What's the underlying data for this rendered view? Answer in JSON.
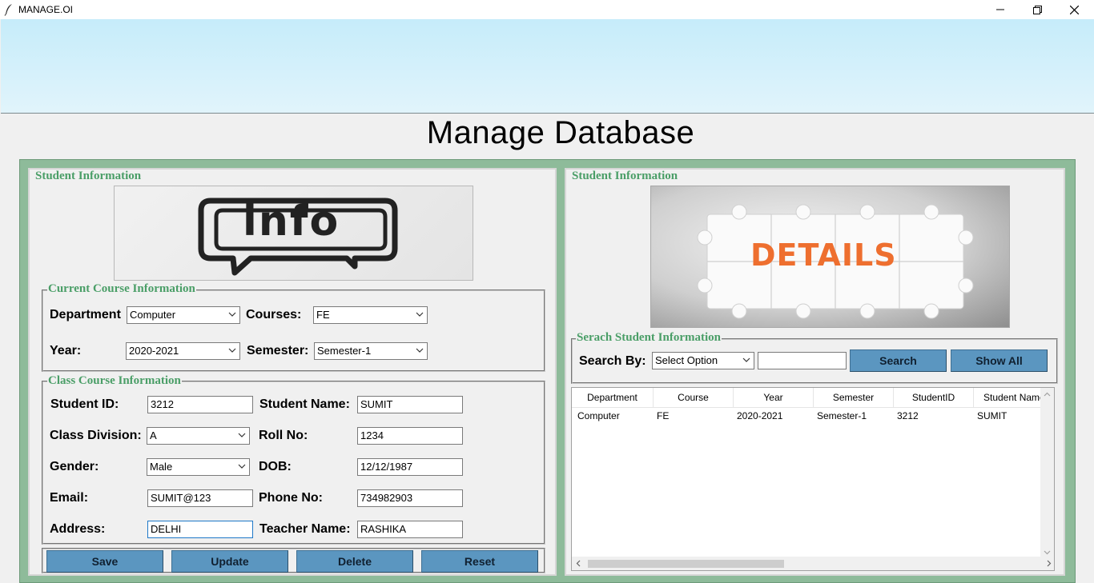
{
  "window": {
    "title": "MANAGE.OI",
    "app_icon": "feather-icon"
  },
  "page": {
    "title": "Manage Database"
  },
  "left_panel": {
    "title": "Student Information",
    "image_text": "info",
    "current_course": {
      "legend": "Current Course Information",
      "department_label": "Department",
      "department_value": "Computer",
      "courses_label": "Courses:",
      "courses_value": "FE",
      "year_label": "Year:",
      "year_value": "2020-2021",
      "semester_label": "Semester:",
      "semester_value": "Semester-1"
    },
    "class_course": {
      "legend": "Class Course Information",
      "student_id_label": "Student ID:",
      "student_id_value": "3212",
      "student_name_label": "Student Name:",
      "student_name_value": "SUMIT",
      "class_division_label": "Class Division:",
      "class_division_value": "A",
      "roll_no_label": "Roll No:",
      "roll_no_value": "1234",
      "gender_label": "Gender:",
      "gender_value": "Male",
      "dob_label": "DOB:",
      "dob_value": "12/12/1987",
      "email_label": "Email:",
      "email_value": "SUMIT@123",
      "phone_label": "Phone No:",
      "phone_value": "734982903",
      "address_label": "Address:",
      "address_value": "DELHI",
      "teacher_label": "Teacher Name:",
      "teacher_value": "RASHIKA"
    },
    "buttons": {
      "save": "Save",
      "update": "Update",
      "delete": "Delete",
      "reset": "Reset"
    }
  },
  "right_panel": {
    "title": "Student Information",
    "image_text": "DETAILS",
    "search": {
      "legend": "Serach Student Information",
      "label": "Search By:",
      "select_value": "Select Option",
      "input_value": "",
      "search_button": "Search",
      "show_all_button": "Show All"
    },
    "table": {
      "columns": [
        "Department",
        "Course",
        "Year",
        "Semester",
        "StudentID",
        "Student Name"
      ],
      "rows": [
        [
          "Computer",
          "FE",
          "2020-2021",
          "Semester-1",
          "3212",
          "SUMIT"
        ]
      ]
    }
  },
  "colors": {
    "accent_green": "#4a9e67",
    "frame_green": "#8ebb9a",
    "button_blue": "#5b96c0"
  }
}
